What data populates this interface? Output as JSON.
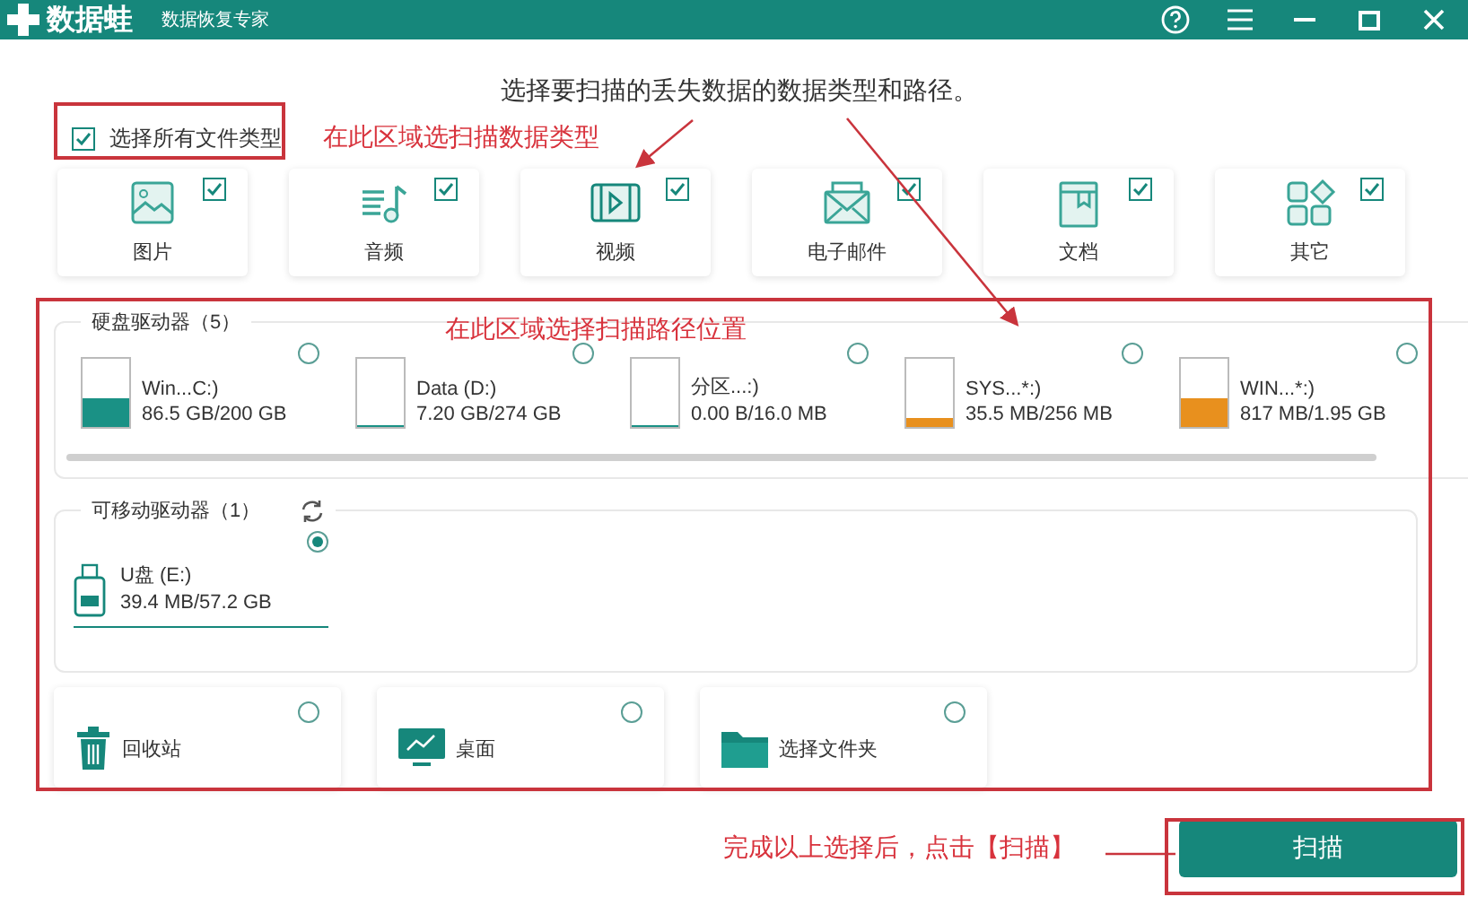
{
  "window": {
    "app_name": "数据蛙",
    "subtitle": "数据恢复专家"
  },
  "heading": "选择要扫描的丢失数据的数据类型和路径。",
  "select_all": {
    "label": "选择所有文件类型",
    "checked": true
  },
  "file_types": [
    {
      "kind": "image",
      "label": "图片",
      "checked": true
    },
    {
      "kind": "audio",
      "label": "音频",
      "checked": true
    },
    {
      "kind": "video",
      "label": "视频",
      "checked": true
    },
    {
      "kind": "email",
      "label": "电子邮件",
      "checked": true
    },
    {
      "kind": "document",
      "label": "文档",
      "checked": true
    },
    {
      "kind": "other",
      "label": "其它",
      "checked": true
    }
  ],
  "hard_drives": {
    "label": "硬盘驱动器（5）",
    "items": [
      {
        "name": "Win...C:)",
        "usage": "86.5 GB/200 GB",
        "level": 0.43,
        "color": "#1a9185",
        "selected": false
      },
      {
        "name": "Data (D:)",
        "usage": "7.20 GB/274 GB",
        "level": 0.03,
        "color": "#1a9185",
        "selected": false
      },
      {
        "name": "分区...:)",
        "usage": "0.00  B/16.0 MB",
        "level": 0,
        "color": "#1a9185",
        "selected": false
      },
      {
        "name": "SYS...*:)",
        "usage": "35.5 MB/256 MB",
        "level": 0.14,
        "color": "#e8901e",
        "selected": false
      },
      {
        "name": "WIN...*:)",
        "usage": "817 MB/1.95 GB",
        "level": 0.42,
        "color": "#e8901e",
        "selected": false
      }
    ]
  },
  "removable_drives": {
    "label": "可移动驱动器（1）",
    "items": [
      {
        "name": "U盘 (E:)",
        "usage": "39.4 MB/57.2 GB",
        "selected": true
      }
    ]
  },
  "locations": [
    {
      "kind": "recycle",
      "label": "回收站",
      "selected": false
    },
    {
      "kind": "desktop",
      "label": "桌面",
      "selected": false
    },
    {
      "kind": "folder",
      "label": "选择文件夹",
      "selected": false
    }
  ],
  "scan_button": "扫描",
  "annotations": [
    {
      "kind": "types",
      "text": "在此区域选扫描数据类型"
    },
    {
      "kind": "paths",
      "text": "在此区域选择扫描路径位置"
    },
    {
      "kind": "scan",
      "text": "完成以上选择后，点击【扫描】"
    }
  ]
}
